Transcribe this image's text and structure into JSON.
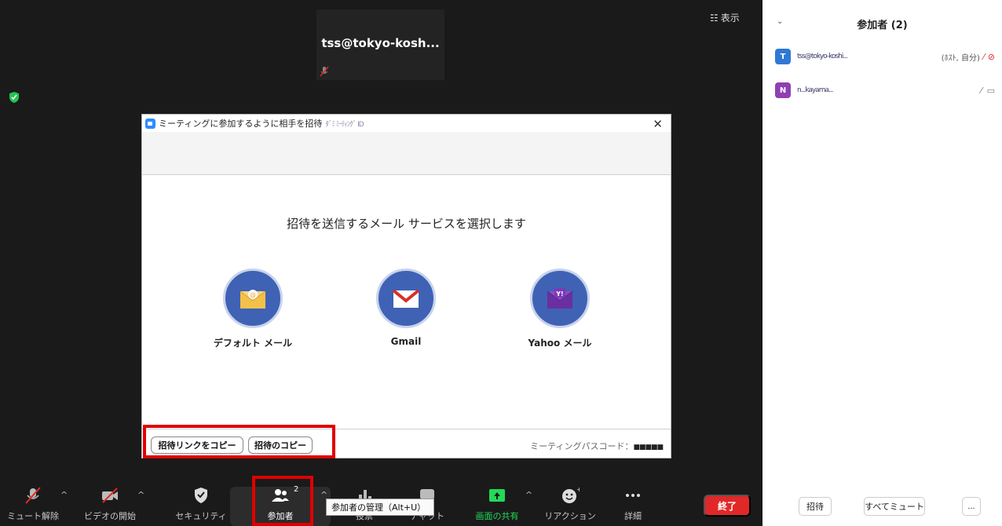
{
  "meeting": {
    "tile_name": "tss@tokyo-kosh...",
    "view_label": "表示"
  },
  "dialog": {
    "title": "ミーティングに参加するように相手を招待",
    "title_blurred": "ﾀﾞﾐ ﾐｰﾃｨﾝｸﾞ ID",
    "heading": "招待を送信するメール サービスを選択します",
    "services": [
      {
        "label": "デフォルト メール",
        "icon": "envelope-at-icon"
      },
      {
        "label": "Gmail",
        "icon": "gmail-icon"
      },
      {
        "label": "Yahoo メール",
        "icon": "yahoo-icon"
      }
    ],
    "copy_link_label": "招待リンクをコピー",
    "copy_invite_label": "招待のコピー",
    "passcode_label": "ミーティングパスコード：",
    "passcode_value": "■■■■■"
  },
  "toolbar": {
    "items": [
      {
        "label": "ミュート解除",
        "icon": "muted-mic-icon"
      },
      {
        "label": "ビデオの開始",
        "icon": "video-off-icon"
      },
      {
        "label": "セキュリティ",
        "icon": "shield-icon"
      },
      {
        "label": "参加者",
        "icon": "participants-icon",
        "count": "2"
      },
      {
        "label": "投票",
        "icon": "poll-icon"
      },
      {
        "label": "チャット",
        "icon": "chat-icon"
      },
      {
        "label": "画面の共有",
        "icon": "share-screen-icon"
      },
      {
        "label": "リアクション",
        "icon": "reaction-icon"
      },
      {
        "label": "詳細",
        "icon": "more-icon"
      }
    ],
    "end_label": "終了",
    "tooltip": "参加者の管理（Alt+U）",
    "share_color": "#23d959"
  },
  "sidebar": {
    "title": "参加者 (2)",
    "participants": [
      {
        "initial": "T",
        "name": "tss@tokyo-koshi...",
        "status": "(ﾎｽﾄ, 自分)",
        "color": "#2f79d4"
      },
      {
        "initial": "N",
        "name": "n...kayama...",
        "status": "",
        "color": "#8f3fb3"
      }
    ],
    "invite_label": "招待",
    "mute_all_label": "すべてミュート",
    "more_label": "..."
  },
  "colors": {
    "highlight_red": "#e00000",
    "end_red": "#e02828"
  }
}
